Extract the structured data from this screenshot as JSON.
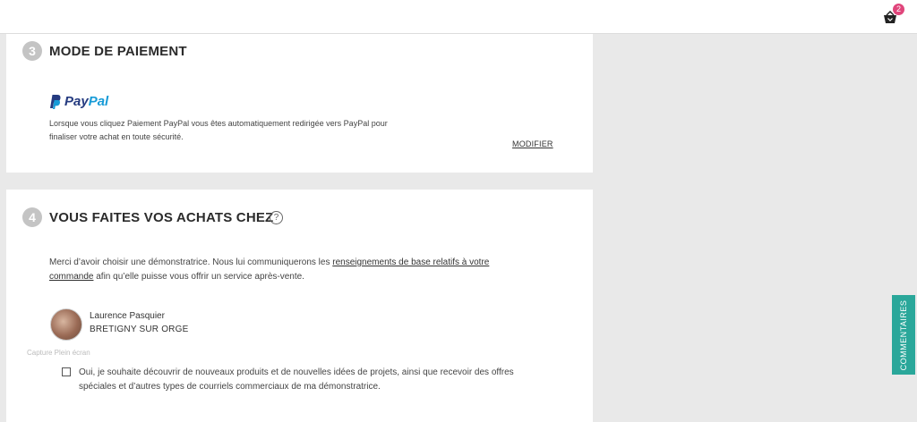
{
  "header": {
    "cart_count": "2"
  },
  "payment": {
    "step_number": "3",
    "title": "MODE DE PAIEMENT",
    "paypal_logo_pay": "Pay",
    "paypal_logo_pal": "Pal",
    "description_line1": "Lorsque vous cliquez Paiement PayPal vous êtes automatiquement redirigée vers PayPal pour",
    "description_line2": "finaliser votre achat en toute sécurité.",
    "modify_label": "MODIFIER"
  },
  "shopping_with": {
    "step_number": "4",
    "title": "VOUS FAITES VOS ACHATS CHEZ",
    "help_symbol": "?",
    "intro_part1": "Merci d’avoir choisir une démonstratrice. Nous lui communiquerons les ",
    "intro_link_line1": "renseignements de base relatifs à votre",
    "intro_link_line2": "commande",
    "intro_part2": " afin qu’elle puisse vous offrir un service après-vente.",
    "demonstrator": {
      "name": "Laurence Pasquier",
      "city": "BRETIGNY SUR ORGE"
    },
    "newsletter_line1": "Oui, je souhaite découvrir de nouveaux produits et de nouvelles idées de projets, ainsi que recevoir des offres",
    "newsletter_line2": "spéciales et d’autres types de courriels commerciaux de ma démonstratrice."
  },
  "overlay": {
    "text": "Capture Plein écran"
  },
  "feedback_tab": {
    "label": "COMMENTAIRES"
  },
  "colors": {
    "accent_teal": "#2aa79a",
    "badge_pink": "#e0457b",
    "paypal_dark": "#253b80",
    "paypal_light": "#179bd7"
  }
}
